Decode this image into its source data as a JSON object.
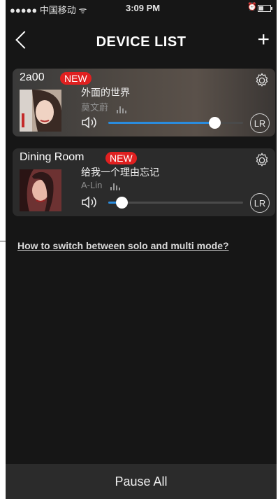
{
  "status_bar": {
    "carrier": "●●●●● 中国移动 ᯤ",
    "time": "3:09 PM",
    "alarm_icon": "alarm-icon",
    "battery_icon": "battery-icon"
  },
  "header": {
    "title": "DEVICE LIST",
    "back_icon": "chevron-left-icon",
    "add_icon": "plus-icon",
    "add_label": "+"
  },
  "devices": [
    {
      "name": "2a00",
      "badge": "NEW",
      "song": "外面的世界",
      "artist": "莫文蔚",
      "volume": 0.79,
      "channel": "LR"
    },
    {
      "name": "Dining Room",
      "badge": "NEW",
      "song": "给我一个理由忘记",
      "artist": "A-Lin",
      "volume": 0.1,
      "channel": "LR"
    }
  ],
  "help_link": "How to switch between solo and multi mode?",
  "footer": {
    "pause_all": "Pause All"
  },
  "colors": {
    "accent": "#2a8cde",
    "badge": "#e02020",
    "background": "#161616"
  }
}
